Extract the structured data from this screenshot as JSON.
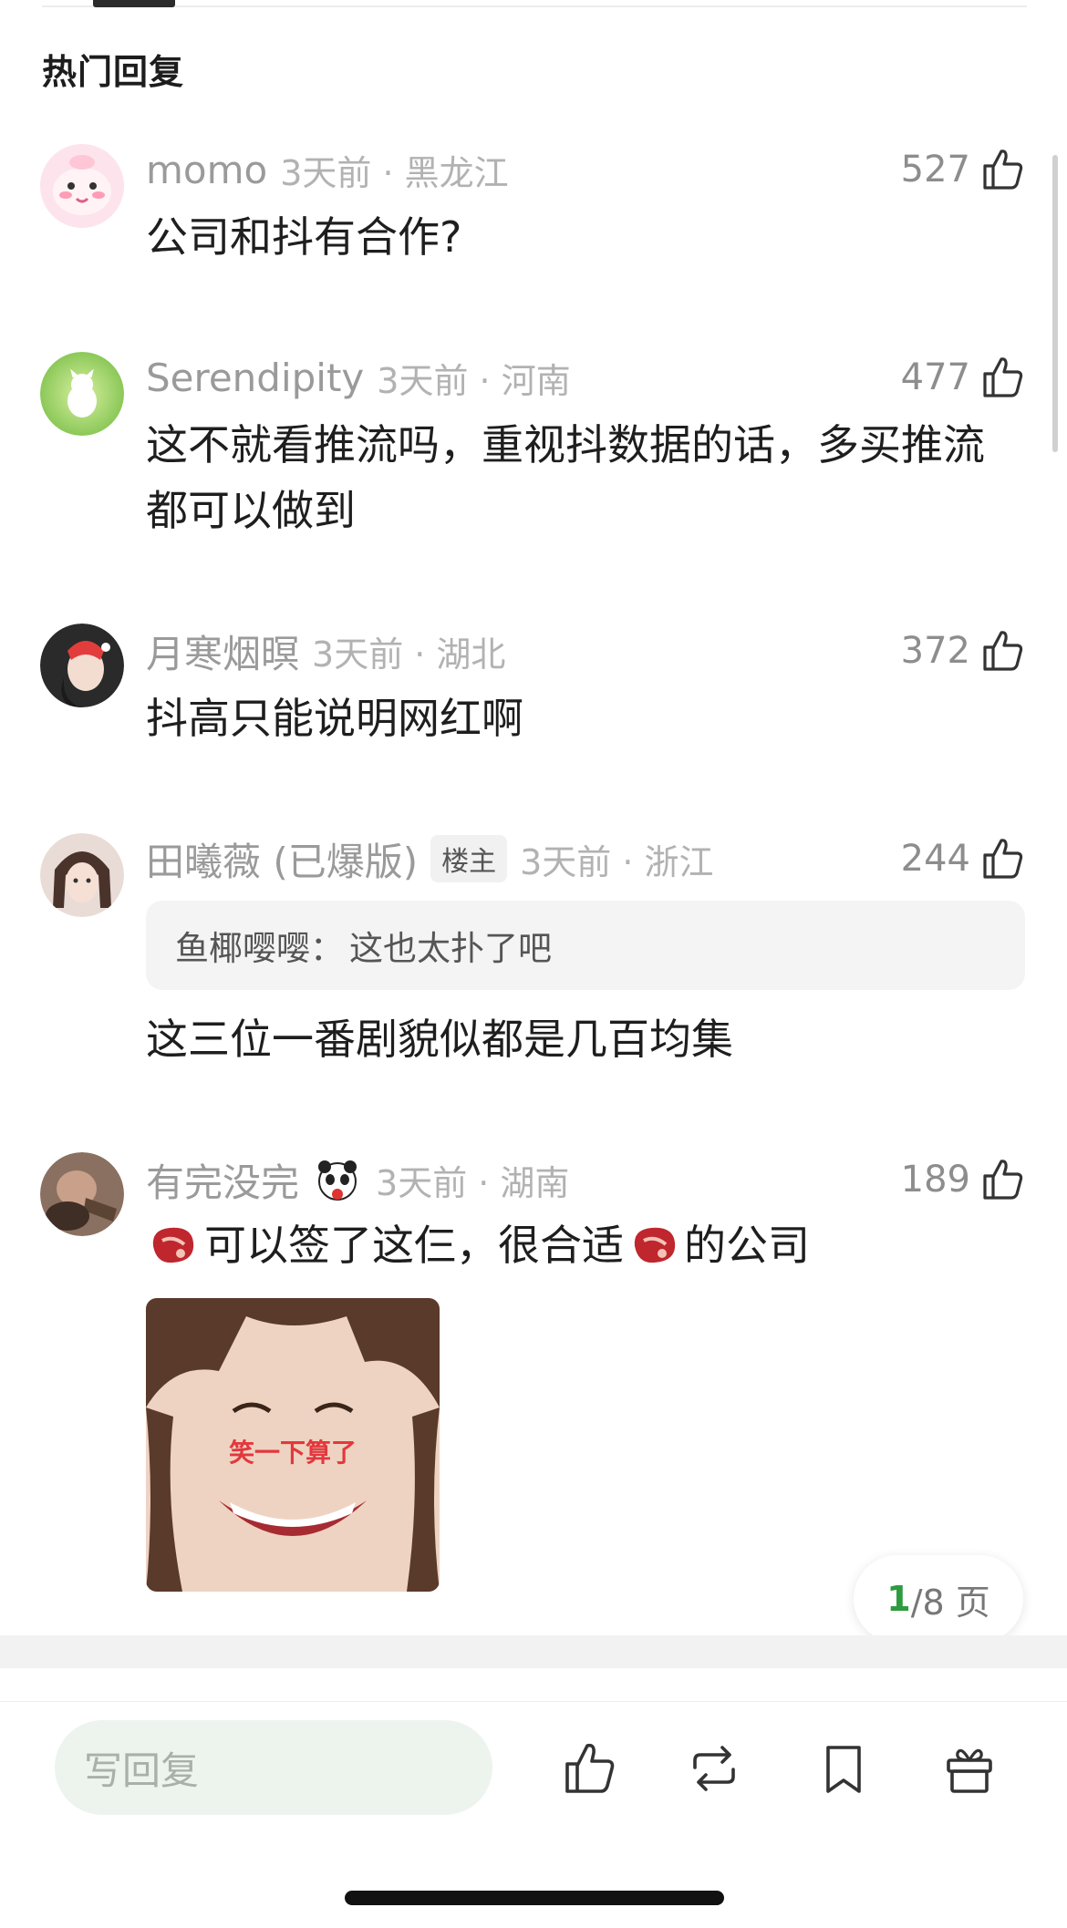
{
  "section_title": "热门回复",
  "comments": [
    {
      "username": "momo",
      "time_location": "3天前 · 黑龙江",
      "likes": "527",
      "text": "公司和抖有合作?"
    },
    {
      "username": "Serendipity",
      "time_location": "3天前 · 河南",
      "likes": "477",
      "text": "这不就看推流吗，重视抖数据的话，多买推流都可以做到"
    },
    {
      "username": "月寒烟暝",
      "time_location": "3天前 · 湖北",
      "likes": "372",
      "text": "抖高只能说明网红啊"
    },
    {
      "username": "田曦薇 (已爆版)",
      "author_tag": "楼主",
      "time_location": "3天前 · 浙江",
      "likes": "244",
      "quote_user": "鱼椰嘤嘤：",
      "quote_text": "这也太扑了吧",
      "text": "这三位一番剧貌似都是几百均集"
    },
    {
      "username": "有完没完",
      "time_location": "3天前 · 湖南",
      "likes": "189",
      "text_part1": "可以签了这仨，很合适",
      "text_part2": "的公司",
      "sticker_caption": "笑一下算了"
    }
  ],
  "pagination": {
    "current": "1",
    "rest": "/8 页"
  },
  "bottom_bar": {
    "reply_placeholder": "写回复"
  },
  "colors": {
    "accent_green": "#2e9b3e",
    "muted_text": "#9a9a9a"
  }
}
